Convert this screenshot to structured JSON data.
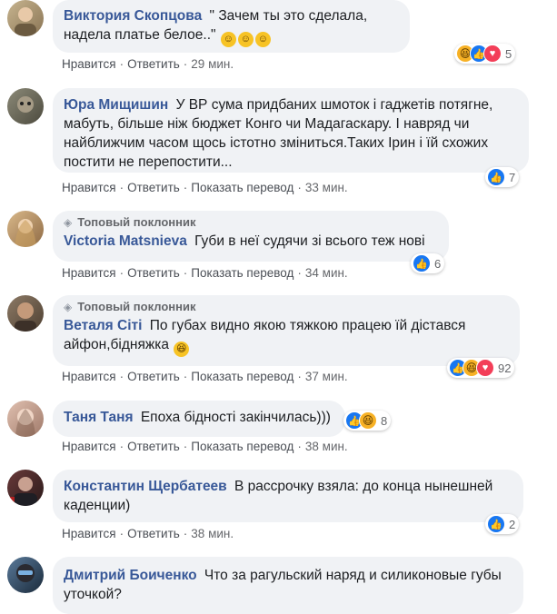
{
  "actions": {
    "like": "Нравится",
    "reply": "Ответить",
    "translate": "Показать перевод",
    "sep": "·"
  },
  "badge_label": "Топовый поклонник",
  "comments": [
    {
      "author": "Виктория Скопцова",
      "text": "\" Зачем ты это сделала, надела платье белое..\"",
      "emoji_suffix": "😊😊😊",
      "time": "29 мин.",
      "reactions": [
        "haha",
        "like",
        "love"
      ],
      "reaction_count": "5",
      "avatar_color": "#9a8a70"
    },
    {
      "author": "Юра Мищишин",
      "text": "У ВР сума придбаних шмоток і гаджетів потягне, мабуть, більше ніж бюджет Конго чи Мадагаскару. І навряд чи найближчим часом щось істотно зміниться.Таких Ірин і їй схожих постити не перепостити...",
      "time": "33 мин.",
      "reactions": [
        "like"
      ],
      "reaction_count": "7",
      "avatar_color": "#7a7a6a"
    },
    {
      "author": "Victoria Matsnieva",
      "badge": true,
      "text": "Губи в неї судячи зі всього теж нові",
      "time": "34 мин.",
      "reactions": [
        "like"
      ],
      "reaction_count": "6",
      "avatar_color": "#c7a47a"
    },
    {
      "author": "Веталя Сіті",
      "badge": true,
      "text": "По губах видно якою тяжкою працею їй дістався айфон,бідняжка",
      "emoji_suffix": "😆",
      "time": "37 мин.",
      "reactions": [
        "like",
        "haha",
        "love"
      ],
      "reaction_count": "92",
      "avatar_color": "#7c6a5a"
    },
    {
      "author": "Таня Таня",
      "text": "Епоха бідності закінчилась)))",
      "time": "38 мин.",
      "reactions": [
        "like",
        "haha"
      ],
      "reaction_count": "8",
      "avatar_color": "#c9a99a"
    },
    {
      "author": "Константин Щербатеев",
      "text": "В рассрочку взяла: до конца нынешней каденции)",
      "time": "38 мин.",
      "reactions": [
        "like"
      ],
      "reaction_count": "2",
      "avatar_color": "#5a3a3a"
    },
    {
      "author": "Дмитрий Боиченко",
      "text": "Что за рагульский наряд и силиконовые губы уточкой?",
      "avatar_color": "#3a5a7a"
    }
  ],
  "colors": {
    "author": "#385898",
    "bubble": "#f0f2f5",
    "like": "#1877f2",
    "haha": "#f7b125",
    "love": "#f33e58"
  }
}
